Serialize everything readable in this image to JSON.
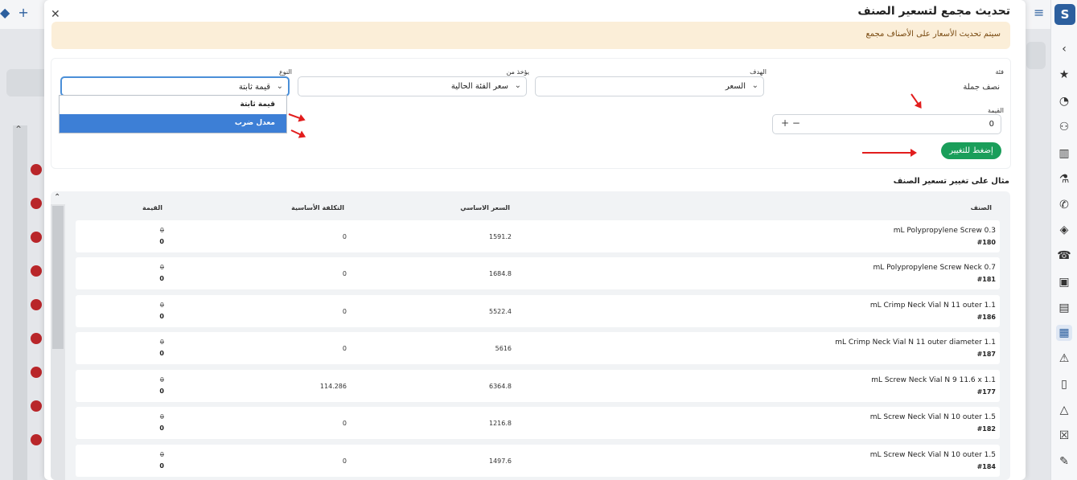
{
  "app": {
    "menu_icon": "hamburger-icon",
    "brand_logo": "S"
  },
  "rail_icons": [
    "chevron-left-icon",
    "star-icon",
    "gauge-icon",
    "users-icon",
    "building-icon",
    "flask-icon",
    "phone-icon",
    "location-icon",
    "telephone-icon",
    "calendar-check-icon",
    "briefcase-icon",
    "cash-icon",
    "warning-icon",
    "device-icon",
    "mountain-icon",
    "calendar-x-icon",
    "edit-icon"
  ],
  "modal": {
    "title": "تحديث مجمع لتسعير الصنف",
    "alert_text": "سيتم تحديث الأسعار على الأصناف مجمع"
  },
  "form": {
    "category_label": "فئة",
    "category_value": "نصف جملة",
    "target_label": "الهدف",
    "target_value": "السعر",
    "source_label": "يؤخذ من",
    "source_value": "سعر الفئة الحالية",
    "type_label": "النوع",
    "type_value": "قيمة ثابتة",
    "type_options": [
      "قيمة ثابتة",
      "معدل ضرب"
    ],
    "amount_label": "القيمة",
    "amount_value": "0",
    "stepper_label": "+ −",
    "apply_label": "إضغط للتغيير"
  },
  "example": {
    "title": "مثال على تغيير تسعير الصنف",
    "headers": {
      "item": "الصنف",
      "base_price": "السعر الاساسي",
      "base_cost": "التكلفة الأساسية",
      "value": "القيمة"
    },
    "rows": [
      {
        "name": "mL Polypropylene Screw 0.3",
        "code": "#180",
        "base_price": "1591.2",
        "base_cost": "0",
        "old_value": "0",
        "new_value": "0"
      },
      {
        "name": "mL Polypropylene Screw Neck 0.7",
        "code": "#181",
        "base_price": "1684.8",
        "base_cost": "0",
        "old_value": "0",
        "new_value": "0"
      },
      {
        "name": "mL Crimp Neck Vial N 11 outer 1.1",
        "code": "#186",
        "base_price": "5522.4",
        "base_cost": "0",
        "old_value": "0",
        "new_value": "0"
      },
      {
        "name": "mL Crimp Neck Vial N 11 outer diameter 1.1",
        "code": "#187",
        "base_price": "5616",
        "base_cost": "0",
        "old_value": "0",
        "new_value": "0"
      },
      {
        "name": "mL Screw Neck Vial N 9 11.6 x 1.1",
        "code": "#177",
        "base_price": "6364.8",
        "base_cost": "114.286",
        "old_value": "0",
        "new_value": "0"
      },
      {
        "name": "mL Screw Neck Vial N 10 outer 1.5",
        "code": "#182",
        "base_price": "1216.8",
        "base_cost": "0",
        "old_value": "0",
        "new_value": "0"
      },
      {
        "name": "mL Screw Neck Vial N 10 outer 1.5",
        "code": "#184",
        "base_price": "1497.6",
        "base_cost": "0",
        "old_value": "0",
        "new_value": "0"
      }
    ]
  },
  "colors": {
    "accent": "#2c5f9e",
    "apply_button": "#1a9e5a",
    "alert_bg": "#fbeed8",
    "annotation_arrow": "#e21d1d",
    "dropdown_selected": "#3d7fd6"
  }
}
